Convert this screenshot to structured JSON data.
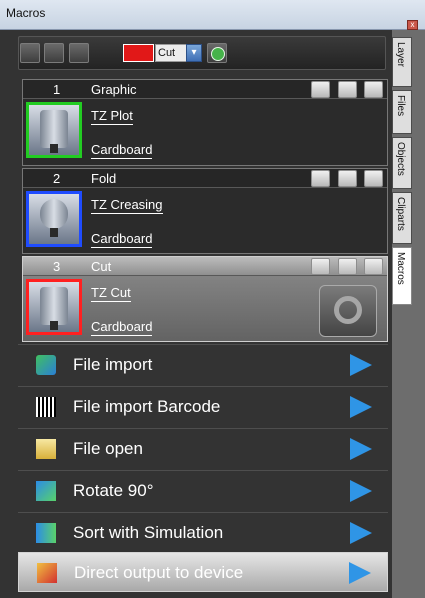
{
  "window": {
    "title": "Macros",
    "close_label": "x"
  },
  "toolbar": {
    "cut_label": "Cut",
    "cut_color": "#e11818",
    "dropdown_glyph": "▾"
  },
  "macros": [
    {
      "num": "1",
      "name": "Graphic",
      "tool": "TZ Plot",
      "material": "Cardboard",
      "border": "#22cc22"
    },
    {
      "num": "2",
      "name": "Fold",
      "tool": "TZ Creasing",
      "material": "Cardboard",
      "border": "#1f4cff"
    },
    {
      "num": "3",
      "name": "Cut",
      "tool": "TZ Cut",
      "material": "Cardboard",
      "border": "#ff2020"
    }
  ],
  "actions": [
    {
      "label": "File import",
      "icon": "import-icon"
    },
    {
      "label": "File import Barcode",
      "icon": "barcode-icon"
    },
    {
      "label": "File open",
      "icon": "file-open-icon"
    },
    {
      "label": "Rotate 90°",
      "icon": "rotate-icon"
    },
    {
      "label": "Sort with Simulation",
      "icon": "sort-icon"
    },
    {
      "label": "Direct output to device",
      "icon": "direct-output-icon"
    }
  ],
  "side_tabs": [
    "Layer",
    "Files",
    "Objects",
    "Cliparts",
    "Macros"
  ]
}
